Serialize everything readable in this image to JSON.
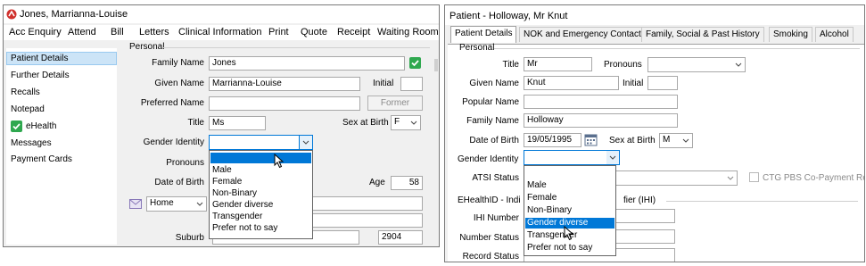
{
  "left_window": {
    "title": "Jones, Marrianna-Louise",
    "menu": [
      "Acc Enquiry",
      "Attend",
      "Bill",
      "Letters",
      "Clinical Information",
      "Print",
      "Quote",
      "Receipt",
      "Waiting Room"
    ],
    "sidebar": [
      "Patient Details",
      "Further Details",
      "Recalls",
      "Notepad",
      "eHealth",
      "Messages",
      "Payment Cards"
    ],
    "group_title": "Personal",
    "fields": {
      "family_name_label": "Family Name",
      "family_name": "Jones",
      "given_name_label": "Given Name",
      "given_name": "Marrianna-Louise",
      "initial_label": "Initial",
      "preferred_name_label": "Preferred Name",
      "former_button": "Former",
      "title_label": "Title",
      "title": "Ms",
      "sex_label": "Sex at Birth",
      "sex": "F",
      "gender_label": "Gender Identity",
      "gender": "",
      "pronouns_label": "Pronouns",
      "dob_label": "Date of Birth",
      "age_label": "Age",
      "age": "58",
      "address_type": "Home",
      "suburb_label": "Suburb",
      "postcode": "2904"
    },
    "gender_options": [
      "Male",
      "Female",
      "Non-Binary",
      "Gender diverse",
      "Transgender",
      "Prefer not to say"
    ]
  },
  "right_window": {
    "title": "Patient - Holloway, Mr Knut",
    "tabs": [
      "Patient Details",
      "NOK and Emergency Contact",
      "Family, Social & Past History",
      "Smoking",
      "Alcohol"
    ],
    "group_title": "Personal",
    "fields": {
      "title_label": "Title",
      "title": "Mr",
      "pronouns_label": "Pronouns",
      "pronouns": "",
      "given_name_label": "Given Name",
      "given_name": "Knut",
      "initial_label": "Initial",
      "popular_name_label": "Popular Name",
      "family_name_label": "Family Name",
      "family_name": "Holloway",
      "dob_label": "Date of Birth",
      "dob": "19/05/1995",
      "sex_label": "Sex at Birth",
      "sex": "M",
      "gender_label": "Gender Identity",
      "gender": "",
      "atsi_label": "ATSI Status",
      "ctg_label": "CTG PBS Co-Payment Relie",
      "ehealth_group": "EHealthID - Indi",
      "ehealth_group_tail": "fier (IHI)",
      "ihi_number_label": "IHI Number",
      "number_status_label": "Number Status",
      "record_status_label": "Record Status"
    },
    "gender_options": [
      "Male",
      "Female",
      "Non-Binary",
      "Gender diverse",
      "Transgender",
      "Prefer not to say"
    ],
    "highlighted_option": "Gender diverse"
  },
  "colors": {
    "selection_blue": "#0078d7",
    "sidebar_highlight": "#cce4f7",
    "check_green": "#2fa84f",
    "logo_red": "#d0312d"
  }
}
